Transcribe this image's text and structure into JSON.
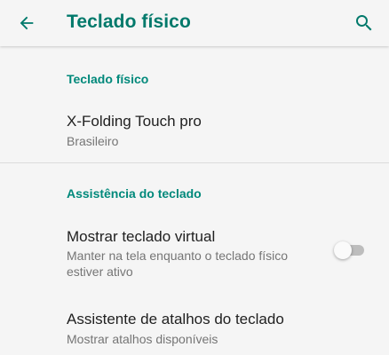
{
  "appbar": {
    "title": "Teclado físico",
    "back_icon": "arrow-back-icon",
    "search_icon": "search-icon",
    "accent_color": "#00796b"
  },
  "sections": {
    "physical": {
      "header": "Teclado físico",
      "keyboard": {
        "name": "X-Folding Touch pro",
        "layout": "Brasileiro"
      }
    },
    "assist": {
      "header": "Assistência do teclado",
      "virtual": {
        "title": "Mostrar teclado virtual",
        "summary_line1": "Manter na tela enquanto o teclado físico",
        "summary_line2": "estiver ativo",
        "enabled": false
      },
      "shortcuts": {
        "title": "Assistente de atalhos do teclado",
        "summary": "Mostrar atalhos disponíveis"
      }
    }
  }
}
